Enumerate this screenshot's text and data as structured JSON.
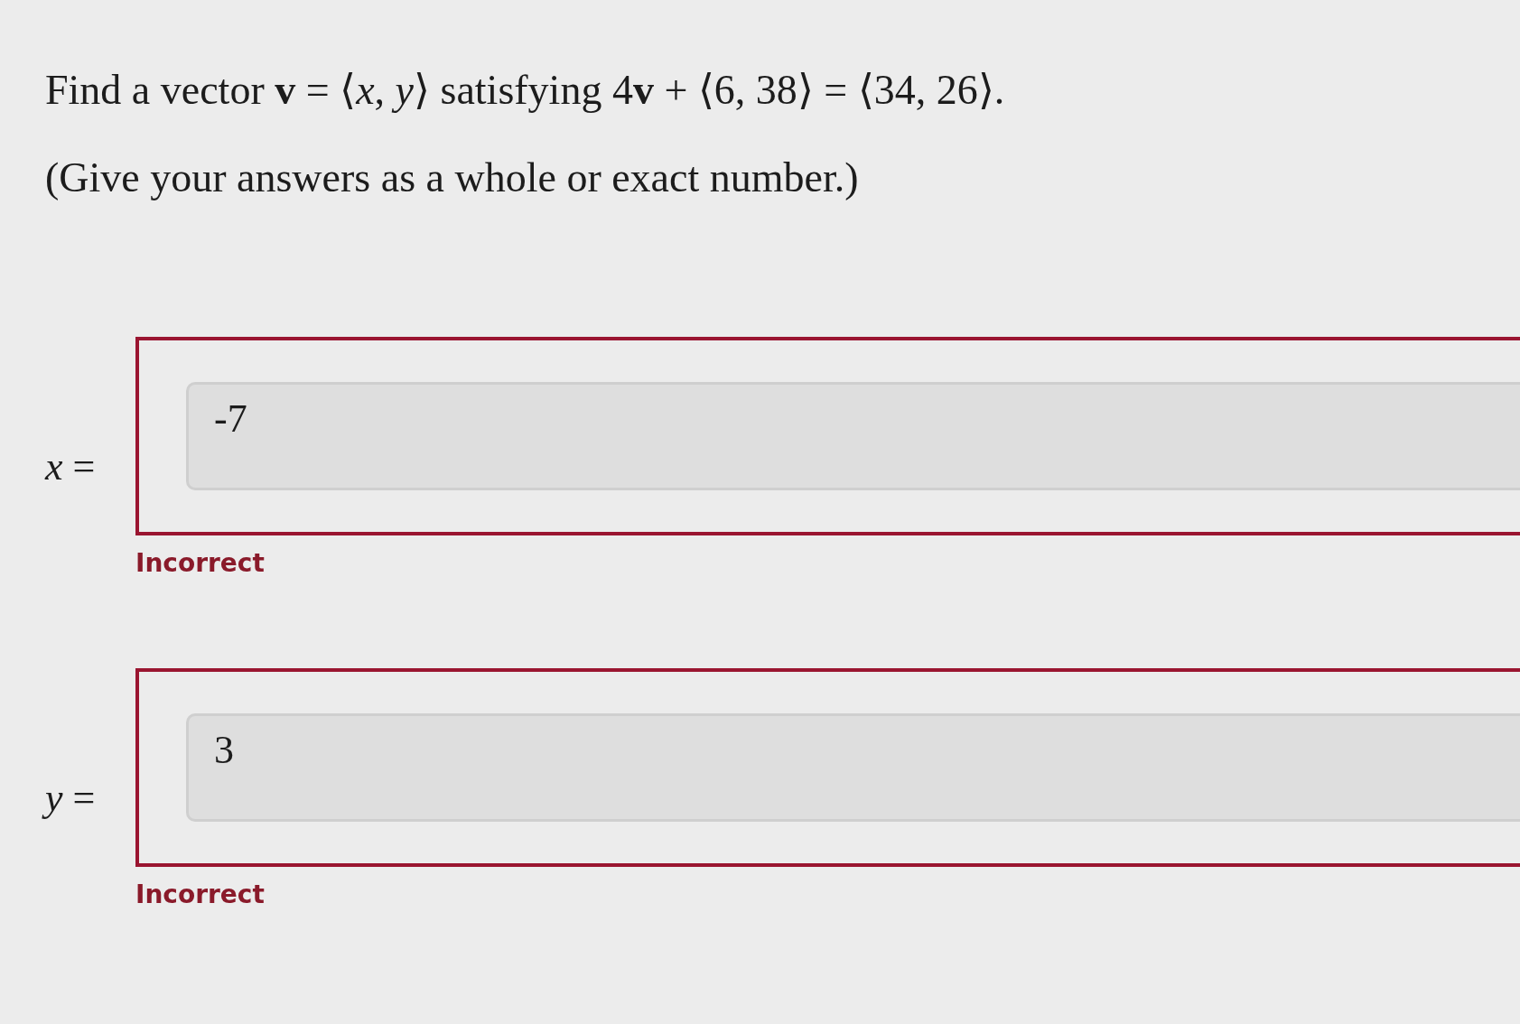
{
  "question": {
    "prompt": "Find a vector **v** = ⟨*x*, *y*⟩ satisfying 4**v** + ⟨6, 38⟩ = ⟨34, 26⟩.",
    "instruction": "(Give your answers as a whole or exact number.)"
  },
  "answers": [
    {
      "label": "*x* =",
      "value": "-7",
      "correct": false,
      "feedback": "Incorrect"
    },
    {
      "label": "*y* =",
      "value": "3",
      "correct": false,
      "feedback": "Incorrect"
    }
  ]
}
